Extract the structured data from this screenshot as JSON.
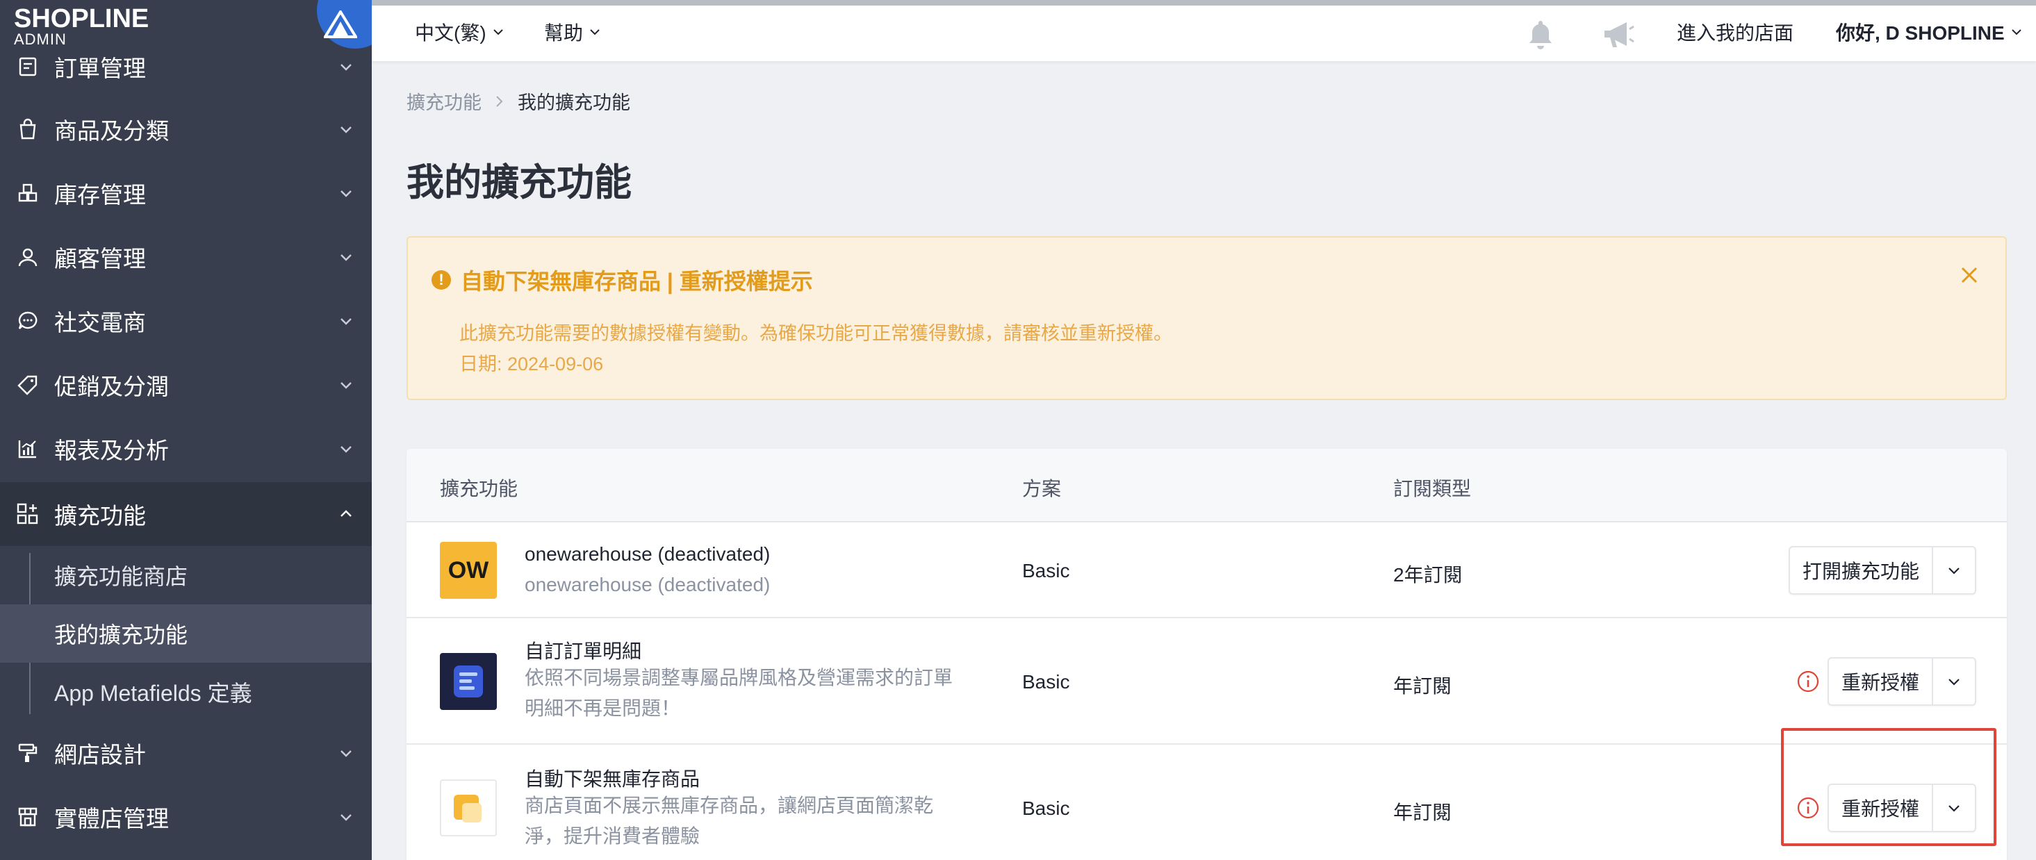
{
  "logo": {
    "text": "SHOPLINE",
    "sub": "ADMIN"
  },
  "sidebar": {
    "items": [
      {
        "label": "訂單管理",
        "icon": "order-icon"
      },
      {
        "label": "商品及分類",
        "icon": "bag-icon"
      },
      {
        "label": "庫存管理",
        "icon": "inventory-icon"
      },
      {
        "label": "顧客管理",
        "icon": "user-icon"
      },
      {
        "label": "社交電商",
        "icon": "chat-icon"
      },
      {
        "label": "促銷及分潤",
        "icon": "tag-icon"
      },
      {
        "label": "報表及分析",
        "icon": "chart-icon"
      },
      {
        "label": "擴充功能",
        "icon": "apps-icon"
      },
      {
        "label": "網店設計",
        "icon": "paint-roller-icon"
      },
      {
        "label": "實體店管理",
        "icon": "store-icon"
      }
    ],
    "sub_items": [
      {
        "label": "擴充功能商店"
      },
      {
        "label": "我的擴充功能"
      },
      {
        "label": "App Metafields 定義"
      }
    ]
  },
  "topbar": {
    "language": "中文(繁)",
    "help": "幫助",
    "enter_store": "進入我的店面",
    "greeting": "你好, D SHOPLINE"
  },
  "breadcrumb": {
    "parent": "擴充功能",
    "current": "我的擴充功能"
  },
  "page_title": "我的擴充功能",
  "alert": {
    "title": "自動下架無庫存商品 | 重新授權提示",
    "message": "此擴充功能需要的數據授權有變動。為確保功能可正常獲得數據，請審核並重新授權。",
    "date": "日期: 2024-09-06",
    "accent_color": "#e39b1b"
  },
  "table": {
    "headers": {
      "app": "擴充功能",
      "plan": "方案",
      "subscription": "訂閱類型"
    },
    "rows": [
      {
        "name": "onewarehouse (deactivated)",
        "desc": "onewarehouse (deactivated)",
        "plan": "Basic",
        "subscription": "2年訂閱",
        "action": "打開擴充功能",
        "logo_text": "OW"
      },
      {
        "name": "自訂訂單明細",
        "desc": "依照不同場景調整專屬品牌風格及營運需求的訂單明細不再是問題！",
        "plan": "Basic",
        "subscription": "年訂閱",
        "action": "重新授權"
      },
      {
        "name": "自動下架無庫存商品",
        "desc": "商店頁面不展示無庫存商品，讓網店頁面簡潔乾淨，提升消費者體驗",
        "plan": "Basic",
        "subscription": "年訂閱",
        "action": "重新授權"
      }
    ]
  }
}
